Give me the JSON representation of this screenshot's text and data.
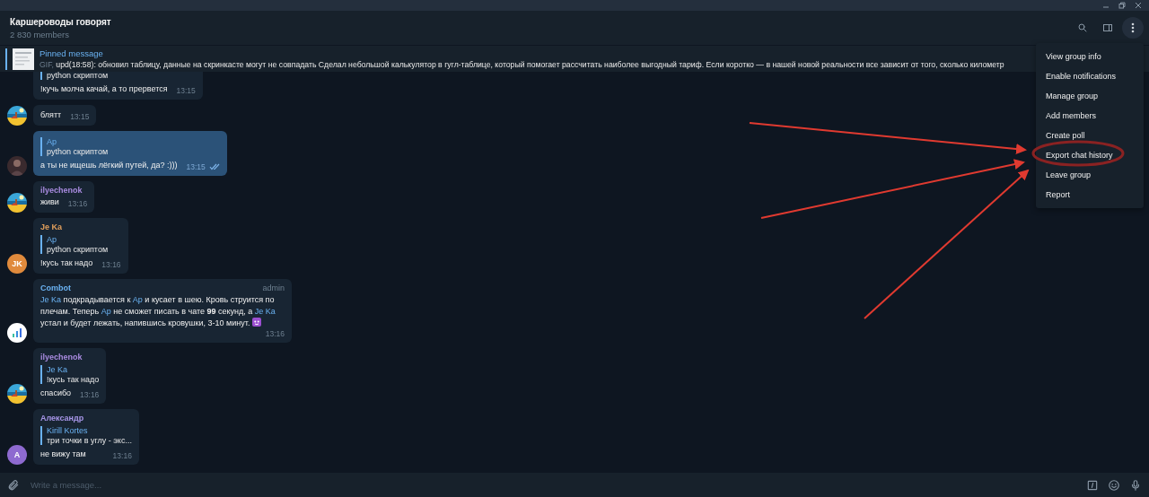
{
  "header": {
    "title": "Каршероводы говорят",
    "subtitle": "2 830 members"
  },
  "pinned": {
    "label": "Pinned message",
    "prefix": "GIF,",
    "text": "upd(18:58): обновил таблицу, данные на скринкасте могут не совпадать  Сделал небольшой калькулятор в гугл-таблице, который помогает рассчитать наиболее выгодный тариф.  Если коротко — в нашей новой реальности все зависит от того, сколько километр"
  },
  "messages": [
    {
      "kind": "incoming",
      "reply": {
        "text": "python скриптом"
      },
      "segments": [
        {
          "kind": "plain",
          "text": "!кучь молча качай, а то прервется"
        }
      ],
      "time": "13:15"
    },
    {
      "kind": "incoming",
      "avatar": {
        "kind": "beach"
      },
      "segments": [
        {
          "kind": "plain",
          "text": "блятт"
        }
      ],
      "time": "13:15"
    },
    {
      "kind": "outgoing",
      "read": true,
      "avatar": {
        "kind": "person"
      },
      "reply": {
        "author": "Ар",
        "text": "python скриптом"
      },
      "segments": [
        {
          "kind": "plain",
          "text": "а ты не ищешь лёгкий путей, да? :)))"
        }
      ],
      "time": "13:15"
    },
    {
      "kind": "incoming",
      "author": "ilyechenok",
      "color": "#a98be0",
      "avatar": {
        "kind": "beach"
      },
      "segments": [
        {
          "kind": "plain",
          "text": "живи"
        }
      ],
      "time": "13:16"
    },
    {
      "kind": "incoming",
      "author": "Je Ka",
      "color": "#e3a05c",
      "avatar": {
        "kind": "initials",
        "initials": "JK",
        "color": "#e08a3c"
      },
      "reply": {
        "author": "Ар",
        "text": "python скриптом"
      },
      "segments": [
        {
          "kind": "plain",
          "text": "!кусь так надо"
        }
      ],
      "time": "13:16"
    },
    {
      "kind": "incoming",
      "author": "Combot",
      "color": "#6ab2f2",
      "badge": "admin",
      "avatar": {
        "kind": "bot"
      },
      "segments": [
        {
          "kind": "mention",
          "text": "Je Ka"
        },
        {
          "kind": "plain",
          "text": " подкрадывается к "
        },
        {
          "kind": "mention",
          "text": "Ар"
        },
        {
          "kind": "plain",
          "text": " и кусает в шею. Кровь струится по плечам. Теперь "
        },
        {
          "kind": "mention",
          "text": "Ар"
        },
        {
          "kind": "plain",
          "text": " не сможет писать в чате **99** секунд, а "
        },
        {
          "kind": "mention",
          "text": "Je Ka"
        },
        {
          "kind": "plain",
          "text": " устал и будет лежать, напившись кровушки, 3-10 минут. "
        },
        {
          "kind": "emoji"
        }
      ],
      "time": "13:16"
    },
    {
      "kind": "incoming",
      "author": "ilyechenok",
      "color": "#a98be0",
      "avatar": {
        "kind": "beach"
      },
      "reply": {
        "author": "Je Ka",
        "text": "!кусь так надо"
      },
      "segments": [
        {
          "kind": "plain",
          "text": "спасибо"
        }
      ],
      "time": "13:16"
    },
    {
      "kind": "incoming",
      "author": "Александр",
      "color": "#a695e7",
      "avatar": {
        "kind": "initials",
        "initials": "А",
        "color": "#8e6ad0"
      },
      "reply": {
        "author": "Kirill Kortes",
        "text": "три точки в углу - экс..."
      },
      "segments": [
        {
          "kind": "plain",
          "text": "не вижу там"
        }
      ],
      "time": "13:16"
    }
  ],
  "menu": {
    "items": [
      "View group info",
      "Enable notifications",
      "Manage group",
      "Add members",
      "Create poll",
      "Export chat history",
      "Leave group",
      "Report"
    ]
  },
  "composer": {
    "placeholder": "Write a message..."
  }
}
